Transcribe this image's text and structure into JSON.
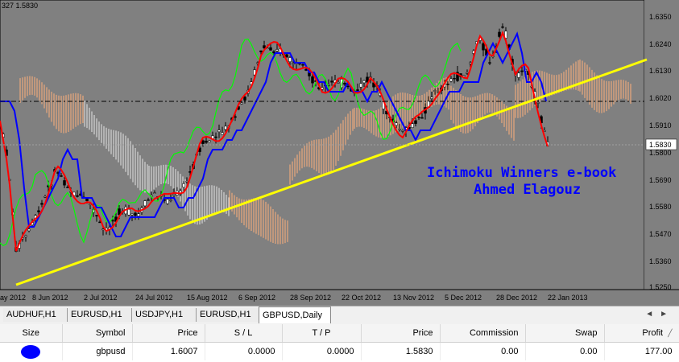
{
  "chart": {
    "header_text": "327 1.5830",
    "price_labels": [
      "1.6350",
      "1.6240",
      "1.6130",
      "1.6020",
      "1.5910",
      "1.5800",
      "1.5690",
      "1.5580",
      "1.5470",
      "1.5360",
      "1.5250"
    ],
    "current_price": "1.5830",
    "date_labels": [
      "ay 2012",
      "8 Jun 2012",
      "2 Jul 2012",
      "24 Jul 2012",
      "15 Aug 2012",
      "6 Sep 2012",
      "28 Sep 2012",
      "22 Oct 2012",
      "13 Nov 2012",
      "5 Dec 2012",
      "28 Dec 2012",
      "22 Jan 2013"
    ],
    "watermark_line1": "Ichimoku Winners e-book",
    "watermark_line2": "Ahmed Elagouz",
    "colors": {
      "background": "#808080",
      "candle": "#000000",
      "tenkan": "#ff0000",
      "kijun": "#0000ff",
      "chikou": "#00ff00",
      "cloud_bull": "#ffb07a",
      "cloud_bear": "#e6e6e6",
      "trendline": "#ffff00",
      "watermark": "#0000ff"
    }
  },
  "tabs": [
    {
      "label": "AUDHUF,H1",
      "active": false
    },
    {
      "label": "EURUSD,H1",
      "active": false
    },
    {
      "label": "USDJPY,H1",
      "active": false
    },
    {
      "label": "EURUSD,H1",
      "active": false
    },
    {
      "label": "GBPUSD,Daily",
      "active": true
    }
  ],
  "orders": {
    "columns": [
      "Size",
      "Symbol",
      "Price",
      "S / L",
      "T / P",
      "Price",
      "Commission",
      "Swap",
      "Profit"
    ],
    "rows": [
      {
        "symbol": "gbpusd",
        "price": "1.6007",
        "sl": "0.0000",
        "tp": "0.0000",
        "price2": "1.5830",
        "commission": "0.00",
        "swap": "0.00",
        "profit": "177.00"
      }
    ],
    "sort_icon": "sort-icon"
  }
}
